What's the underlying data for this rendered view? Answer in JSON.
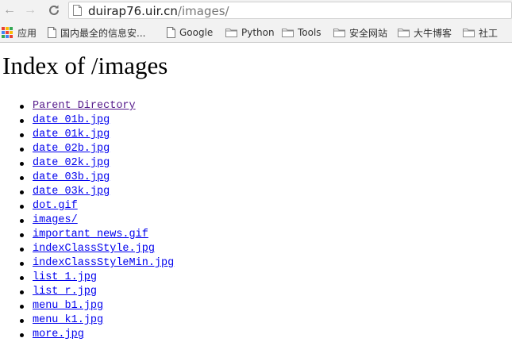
{
  "browser": {
    "url_host": "duirap76.uir.cn",
    "url_path": "/images/"
  },
  "bookmarks": [
    {
      "label": "应用",
      "icon": "apps-icon"
    },
    {
      "label": "国内最全的信息安...",
      "icon": "page-icon"
    },
    {
      "label": "Google",
      "icon": "page-icon"
    },
    {
      "label": "Python",
      "icon": "folder-icon"
    },
    {
      "label": "Tools",
      "icon": "folder-icon"
    },
    {
      "label": "安全网站",
      "icon": "folder-icon"
    },
    {
      "label": "大牛博客",
      "icon": "folder-icon"
    },
    {
      "label": "社工",
      "icon": "folder-icon"
    }
  ],
  "page": {
    "title": "Index of /images",
    "entries": [
      "Parent Directory",
      "date_01b.jpg",
      "date_01k.jpg",
      "date_02b.jpg",
      "date_02k.jpg",
      "date_03b.jpg",
      "date_03k.jpg",
      "dot.gif",
      "images/",
      "important_news.gif",
      "indexClassStyle.jpg",
      "indexClassStyleMin.jpg",
      "list_1.jpg",
      "list_r.jpg",
      "menu_b1.jpg",
      "menu_k1.jpg",
      "more.jpg"
    ]
  },
  "colors": {
    "link": "#0000ee",
    "visited_link": "#551a8b",
    "folder": "#e8b84a"
  }
}
